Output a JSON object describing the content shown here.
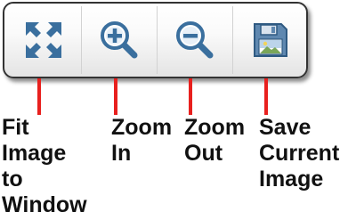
{
  "toolbar": {
    "buttons": [
      {
        "icon": "fit-to-window-icon",
        "label": "Fit\nImage\nto\nWindow"
      },
      {
        "icon": "zoom-in-icon",
        "label": "Zoom\nIn"
      },
      {
        "icon": "zoom-out-icon",
        "label": "Zoom\nOut"
      },
      {
        "icon": "save-image-icon",
        "label": "Save\nCurrent\nImage"
      }
    ]
  },
  "colors": {
    "icon_blue": "#3a6f9e",
    "icon_light_blue": "#8ab0d4",
    "leader_red": "#e8201e",
    "toolbar_border": "#333333"
  }
}
